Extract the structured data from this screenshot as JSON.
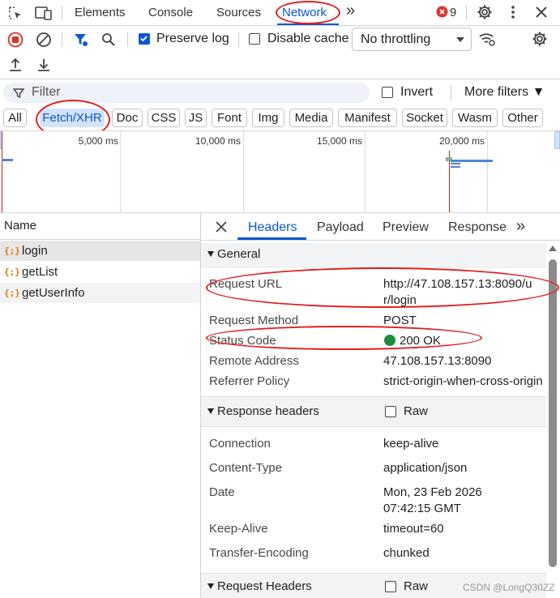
{
  "toolbar": {
    "tabs": [
      "Elements",
      "Console",
      "Sources",
      "Network"
    ],
    "more_tabs": "»",
    "error_count": "9"
  },
  "network_toolbar": {
    "preserve_log": "Preserve log",
    "disable_cache": "Disable cache",
    "throttling": "No throttling"
  },
  "filter": {
    "placeholder": "Filter",
    "invert": "Invert",
    "more_filters": "More filters ▼"
  },
  "type_filters": [
    "All",
    "Fetch/XHR",
    "Doc",
    "CSS",
    "JS",
    "Font",
    "Img",
    "Media",
    "Manifest",
    "Socket",
    "Wasm",
    "Other"
  ],
  "timeline": {
    "ticks": [
      "5,000 ms",
      "10,000 ms",
      "15,000 ms",
      "20,000 ms"
    ]
  },
  "request_list": {
    "header": "Name",
    "items": [
      "login",
      "getList",
      "getUserInfo"
    ]
  },
  "details": {
    "tabs": [
      "Headers",
      "Payload",
      "Preview",
      "Response"
    ],
    "general": {
      "title": "General",
      "request_url_key": "Request URL",
      "request_url_line1": "http://47.108.157.13:8090/u",
      "request_url_line2": "r/login",
      "request_method_key": "Request Method",
      "request_method": "POST",
      "status_code_key": "Status Code",
      "status_code": "200 OK",
      "remote_address_key": "Remote Address",
      "remote_address": "47.108.157.13:8090",
      "referrer_policy_key": "Referrer Policy",
      "referrer_policy": "strict-origin-when-cross-origin"
    },
    "response_headers": {
      "title": "Response headers",
      "raw": "Raw",
      "connection_key": "Connection",
      "connection": "keep-alive",
      "content_type_key": "Content-Type",
      "content_type": "application/json",
      "date_key": "Date",
      "date_line1": "Mon, 23 Feb 2026",
      "date_line2": "07:42:15 GMT",
      "keep_alive_key": "Keep-Alive",
      "keep_alive": "timeout=60",
      "transfer_encoding_key": "Transfer-Encoding",
      "transfer_encoding": "chunked"
    },
    "request_headers": {
      "title": "Request Headers",
      "raw": "Raw"
    }
  },
  "watermark": "CSDN @LongQ30ZZ",
  "colors": {
    "accent": "#0b57d0",
    "annotation": "#e02020",
    "status_ok": "#1e8e3e",
    "record": "#d93025"
  }
}
